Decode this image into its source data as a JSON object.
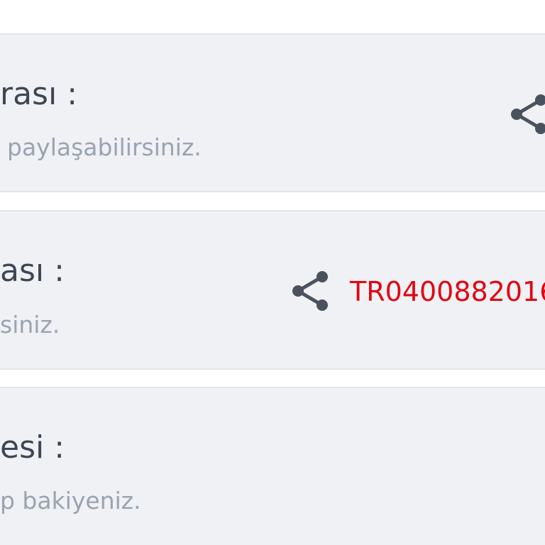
{
  "cards": [
    {
      "title": "rası :",
      "subtitle": "paylaşabilirsiniz.",
      "share_icon": "share-icon"
    },
    {
      "title": "ası :",
      "subtitle": "siniz.",
      "share_icon": "share-icon",
      "iban": "TR0400882016"
    },
    {
      "title": "esi :",
      "subtitle": "p bakiyeniz."
    }
  ],
  "colors": {
    "card_bg": "#eff1f5",
    "title": "#3e4654",
    "subtitle": "#9aa3b1",
    "iban": "#e10612",
    "icon": "#4a525e"
  }
}
